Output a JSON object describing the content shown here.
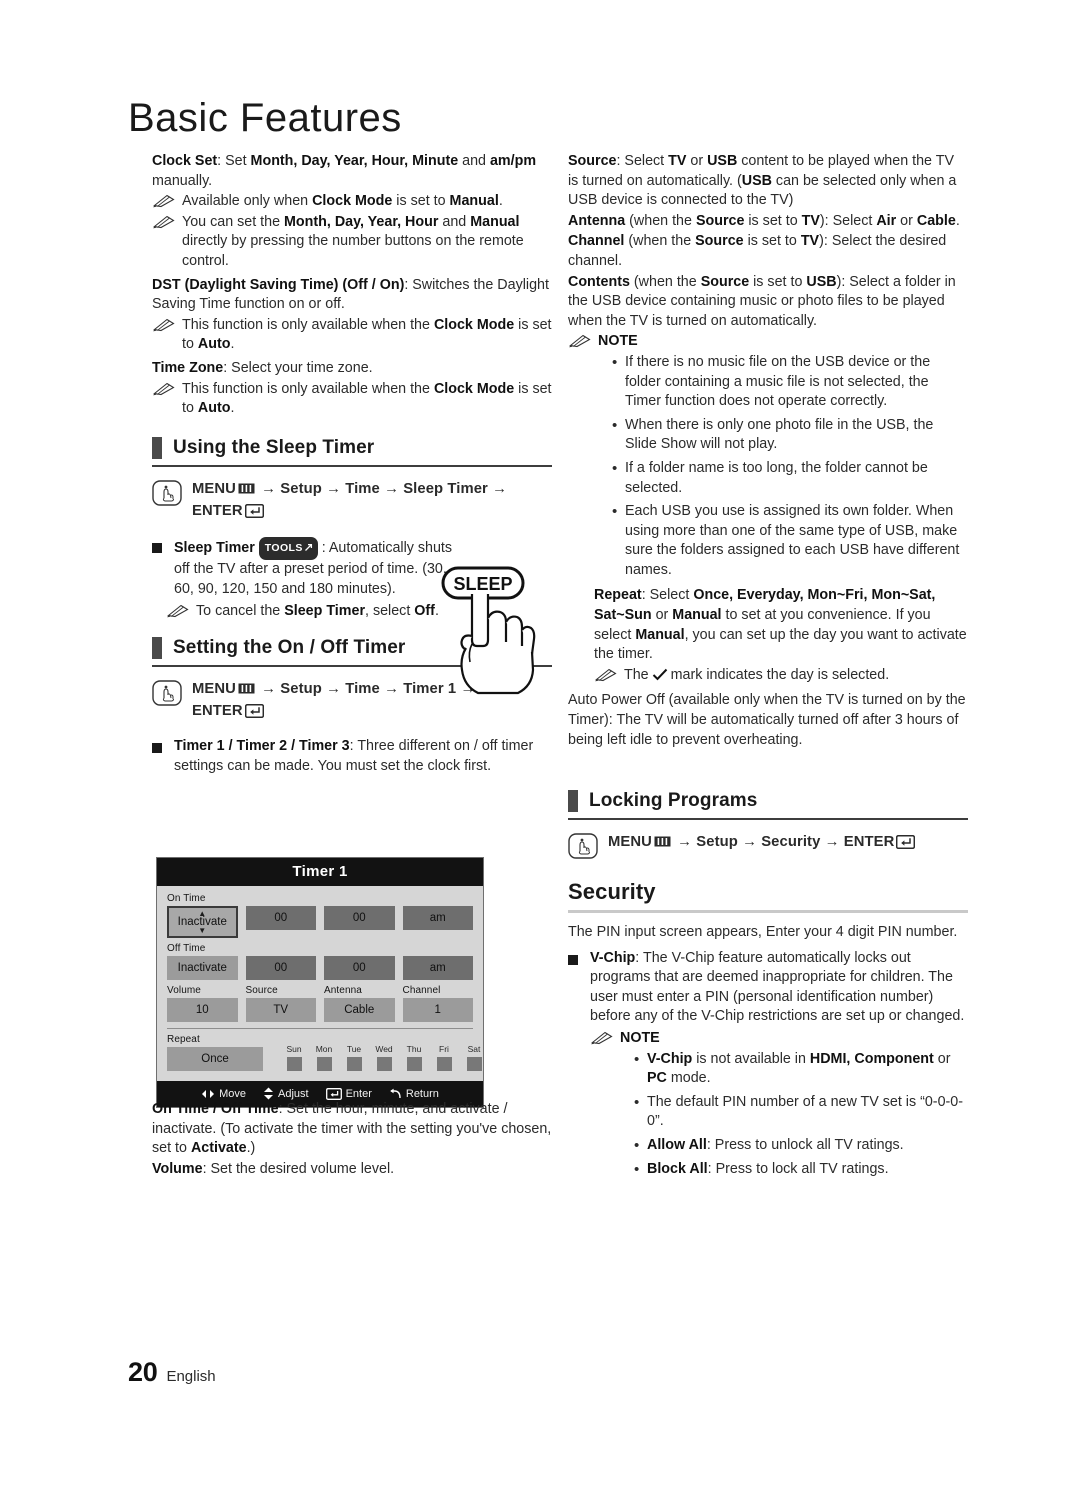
{
  "document": {
    "title": "Basic Features",
    "footer": {
      "page_number": "20",
      "language": "English"
    }
  },
  "left_column": {
    "clock_set": {
      "line1_bold": "Clock Set",
      "line1": ": Set Month, Day, Year, Hour, Minute and am/pm manually.",
      "note1": "Available only when Clock Mode is set to Manual.",
      "note2": "You can set the Month, Day, Year, Hour and Manual directly by pressing the number buttons on the remote control."
    },
    "dst": {
      "label": "DST (Daylight Saving Time) (Off / On)",
      "text": ": Switches the Daylight Saving Time function on or off.",
      "note": "This function is only available when the Clock Mode is set to Auto."
    },
    "time_zone": {
      "label": "Time Zone",
      "text": ": Select your time zone.",
      "note": "This function is only available when the Clock Mode is set to Auto."
    },
    "sleep_timer_section": {
      "heading": "Using the Sleep Timer",
      "menu_path_1": "MENU",
      "menu_path_2": "→ Setup → Time → Sleep Timer →",
      "menu_path_3": "ENTER",
      "item_label": "Sleep Timer",
      "tools_badge": "TOOLS",
      "item_text": ": Automatically shuts off the TV after a preset period of time. (30, 60, 90, 120, 150 and 180 minutes).",
      "note": "To cancel the Sleep Timer, select Off.",
      "remote_button": "SLEEP"
    },
    "on_off_timer_section": {
      "heading": "Setting the On / Off Timer",
      "menu_path_1": "MENU",
      "menu_path_2": "→ Setup → Time → Timer 1 →",
      "menu_path_3": "ENTER",
      "item_label": "Timer 1 / Timer 2 / Timer 3",
      "item_text": ": Three different on / off timer settings can be made. You must set the clock first."
    },
    "after_osd": {
      "on_off_label": "On Time / Off Time",
      "on_off_text": ": Set the hour, minute, and activate / inactivate. (To activate the timer with the setting you've chosen, set to Activate.)",
      "volume_label": "Volume",
      "volume_text": ": Set the desired volume level."
    }
  },
  "osd": {
    "title": "Timer 1",
    "on_time": {
      "label": "On Time",
      "state": "Inactivate",
      "hour": "00",
      "minute": "00",
      "ampm": "am"
    },
    "off_time": {
      "label": "Off Time",
      "state": "Inactivate",
      "hour": "00",
      "minute": "00",
      "ampm": "am"
    },
    "settings": {
      "volume_label": "Volume",
      "volume_value": "10",
      "source_label": "Source",
      "source_value": "TV",
      "antenna_label": "Antenna",
      "antenna_value": "Cable",
      "channel_label": "Channel",
      "channel_value": "1"
    },
    "repeat": {
      "label": "Repeat",
      "value": "Once",
      "days": [
        "Sun",
        "Mon",
        "Tue",
        "Wed",
        "Thu",
        "Fri",
        "Sat"
      ]
    },
    "footer": {
      "move": "Move",
      "adjust": "Adjust",
      "enter": "Enter",
      "return": "Return"
    }
  },
  "right_column": {
    "source": {
      "label": "Source",
      "text": ": Select TV or USB content to be played when the TV is turned on automatically. (USB can be selected only when a USB device is connected to the TV)"
    },
    "antenna": {
      "label": "Antenna",
      "text": " (when the Source is set to TV): Select Air or Cable."
    },
    "channel": {
      "label": "Channel",
      "text": " (when the Source is set to TV): Select the desired channel."
    },
    "contents": {
      "label": "Contents",
      "text": " (when the Source is set to USB): Select a folder in the USB device containing music or photo files to be played when the TV is turned on automatically."
    },
    "note_heading": "NOTE",
    "notes": [
      "If there is no music file on the USB device or the folder containing a music file is not selected, the Timer function does not operate correctly.",
      "When there is only one photo file in the USB, the Slide Show will not play.",
      "If a folder name is too long, the folder cannot be selected.",
      "Each USB you use is assigned its own folder. When using more than one of the same type of USB, make sure the folders assigned to each USB have different names."
    ],
    "repeat": {
      "label": "Repeat",
      "text": ": Select Once, Everyday, Mon~Fri, Mon~Sat, Sat~Sun or Manual to set at you convenience. If you select Manual, you can set up the day you want to activate the timer.",
      "note_pre": "The",
      "note_post": "mark indicates the day is selected."
    },
    "auto_power_off": "Auto Power Off (available only when the TV is turned on by the Timer): The TV will be automatically turned off after 3 hours of being left idle to prevent overheating.",
    "locking_programs": {
      "heading": "Locking Programs",
      "menu_path_1": "MENU",
      "menu_path_2": "→ Setup → Security → ENTER"
    },
    "security": {
      "heading": "Security",
      "intro": "The PIN input screen appears, Enter your 4 digit PIN number.",
      "vchip_label": "V-Chip",
      "vchip_text": ": The V-Chip feature automatically locks out programs that are deemed inappropriate for children. The user must enter a PIN (personal identification number) before any of the V-Chip restrictions are set up or changed.",
      "note_heading": "NOTE",
      "notes": [
        "V-Chip is not available in HDMI, Component or PC mode.",
        "The default PIN number of a new TV set is “0-0-0-0”.",
        "Allow All: Press to unlock all TV ratings.",
        "Block All: Press to lock all TV ratings."
      ]
    }
  }
}
